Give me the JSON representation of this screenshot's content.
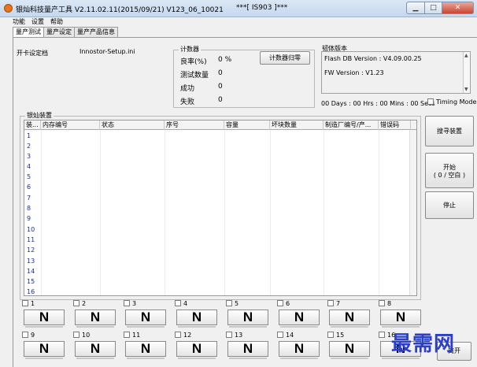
{
  "window": {
    "title": "银灿科技量产工具 V2.11.02.11(2015/09/21)    V123_06_10021",
    "title_suffix": "***[ IS903 ]***"
  },
  "menu": [
    "功能",
    "设置",
    "帮助"
  ],
  "tabs": [
    "量产测试",
    "量产设定",
    "量产产品信息"
  ],
  "setup": {
    "label": "开卡设定档",
    "file": "Innostor-Setup.ini"
  },
  "counter": {
    "title": "计数器",
    "rows": [
      {
        "label": "良率(%)",
        "value": "0 %"
      },
      {
        "label": "测试数量",
        "value": "0"
      },
      {
        "label": "成功",
        "value": "0"
      },
      {
        "label": "失败",
        "value": "0"
      }
    ],
    "reset_label": "计数器归零"
  },
  "firmware": {
    "title": "韧体版本",
    "flash_db": "Flash DB Version :  V4.09.00.25",
    "fw": "FW Version :   V1.23"
  },
  "timer": "00 Days : 00 Hrs : 00 Mins : 00 Secs",
  "timing_mode": "Timing Mode",
  "devices": {
    "title": "银灿装置",
    "columns": [
      "装...",
      "内存编号",
      "状态",
      "序号",
      "容量",
      "坏块数量",
      "制造厂编号/产...",
      "错误码"
    ],
    "rows": [
      "1",
      "2",
      "3",
      "4",
      "5",
      "6",
      "7",
      "8",
      "9",
      "10",
      "11",
      "12",
      "13",
      "14",
      "15",
      "16"
    ]
  },
  "actions": {
    "search": "搜寻装置",
    "start": "开始",
    "start_sub": "( 0 / 空白 )",
    "stop": "停止"
  },
  "slots": {
    "labels": [
      "1",
      "2",
      "3",
      "4",
      "5",
      "6",
      "7",
      "8",
      "9",
      "10",
      "11",
      "12",
      "13",
      "14",
      "15",
      "16"
    ],
    "state": "N"
  },
  "exit_label": "离开",
  "watermark": "最需网"
}
